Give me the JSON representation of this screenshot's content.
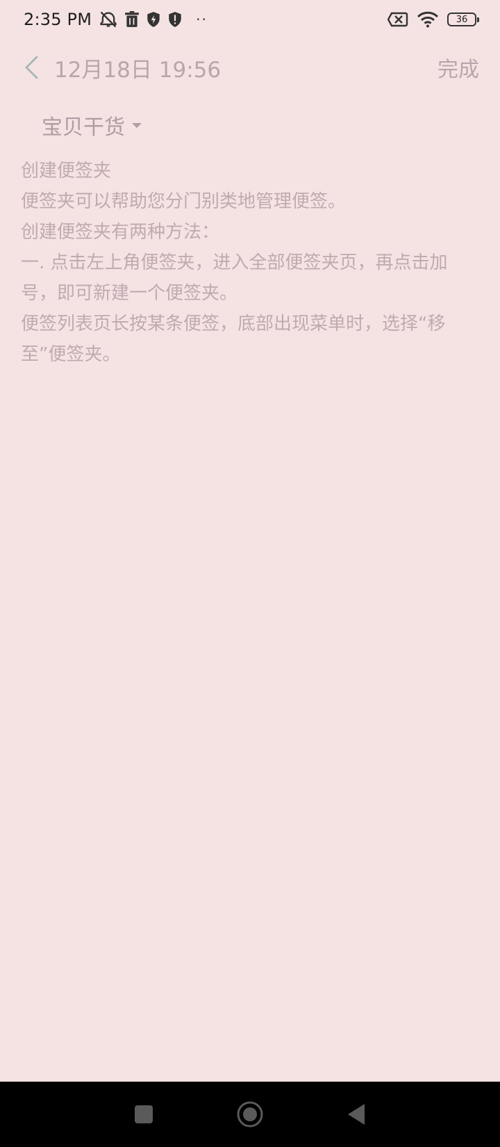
{
  "status_bar": {
    "time": "2:35 PM",
    "battery_level": "36",
    "icons": [
      "alarm-off-icon",
      "trash-icon",
      "shield-bolt-icon",
      "shield-alert-icon",
      "more-dots-icon",
      "sim-off-icon",
      "wifi-icon",
      "battery-icon"
    ]
  },
  "toolbar": {
    "date": "12月18日 19:56",
    "done_label": "完成"
  },
  "folder": {
    "name": "宝贝干货"
  },
  "note": {
    "lines": [
      "创建便签夹",
      "便签夹可以帮助您分门别类地管理便签。",
      "创建便签夹有两种方法：",
      "一. 点击左上角便签夹，进入全部便签夹页，再点击加号，即可新建一个便签夹。",
      "便签列表页长按某条便签，底部出现菜单时，选择“移至”便签夹。"
    ]
  },
  "colors": {
    "background": "#f5e3e4",
    "text_muted": "#c0aab0",
    "nav_bar": "#000000"
  }
}
